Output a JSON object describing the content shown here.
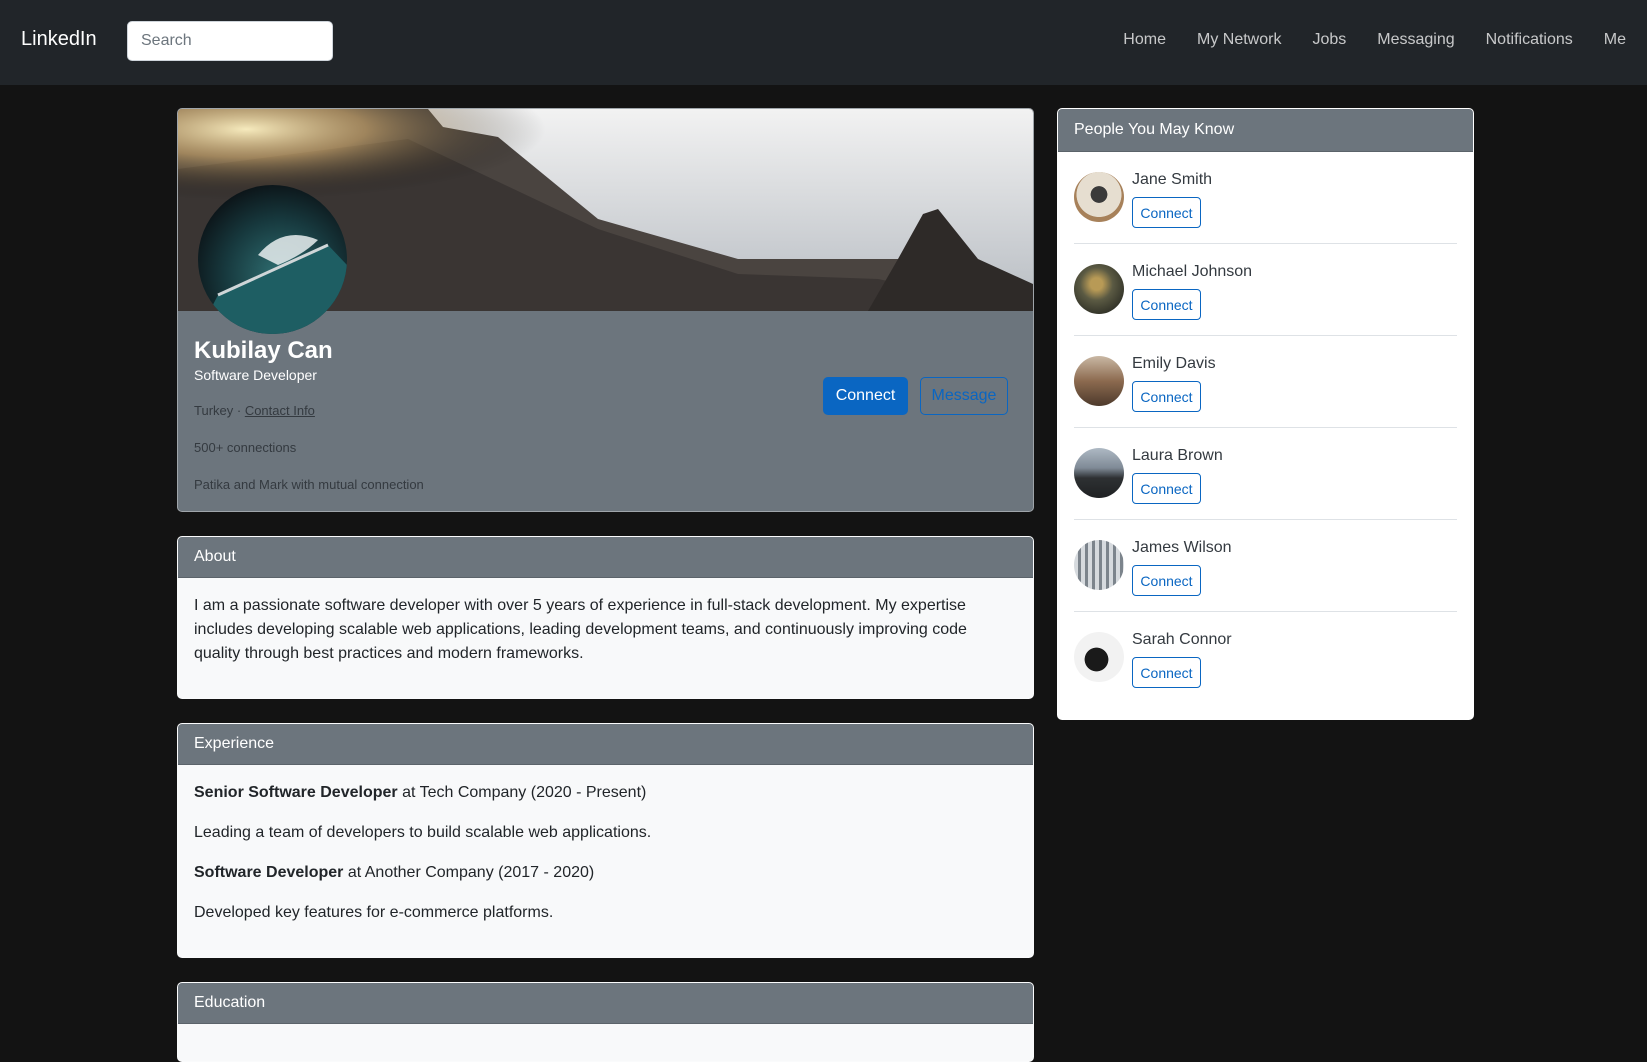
{
  "nav": {
    "brand": "LinkedIn",
    "search_placeholder": "Search",
    "links": [
      "Home",
      "My Network",
      "Jobs",
      "Messaging",
      "Notifications",
      "Me"
    ]
  },
  "profile": {
    "name": "Kubilay Can",
    "title": "Software Developer",
    "location": "Turkey · ",
    "contact_info": "Contact Info",
    "connections": "500+ connections",
    "mutual": "Patika and Mark with mutual connection",
    "connect_label": "Connect",
    "message_label": "Message"
  },
  "about": {
    "header": "About",
    "text": "I am a passionate software developer with over 5 years of experience in full-stack development. My expertise includes developing scalable web applications, leading development teams, and continuously improving code quality through best practices and modern frameworks."
  },
  "experience": {
    "header": "Experience",
    "items": [
      {
        "role": "Senior Software Developer",
        "company": " at Tech Company (2020 - Present)",
        "desc": "Leading a team of developers to build scalable web applications."
      },
      {
        "role": "Software Developer",
        "company": " at Another Company (2017 - 2020)",
        "desc": "Developed key features for e-commerce platforms."
      }
    ]
  },
  "education": {
    "header": "Education"
  },
  "people": {
    "header": "People You May Know",
    "connect_label": "Connect",
    "items": [
      {
        "name": "Jane Smith"
      },
      {
        "name": "Michael Johnson"
      },
      {
        "name": "Emily Davis"
      },
      {
        "name": "Laura Brown"
      },
      {
        "name": "James Wilson"
      },
      {
        "name": "Sarah Connor"
      }
    ]
  },
  "colors": {
    "navbar": "#212529",
    "page_bg": "#131313",
    "card_header": "#6c757d",
    "accent": "#0a66c2"
  }
}
